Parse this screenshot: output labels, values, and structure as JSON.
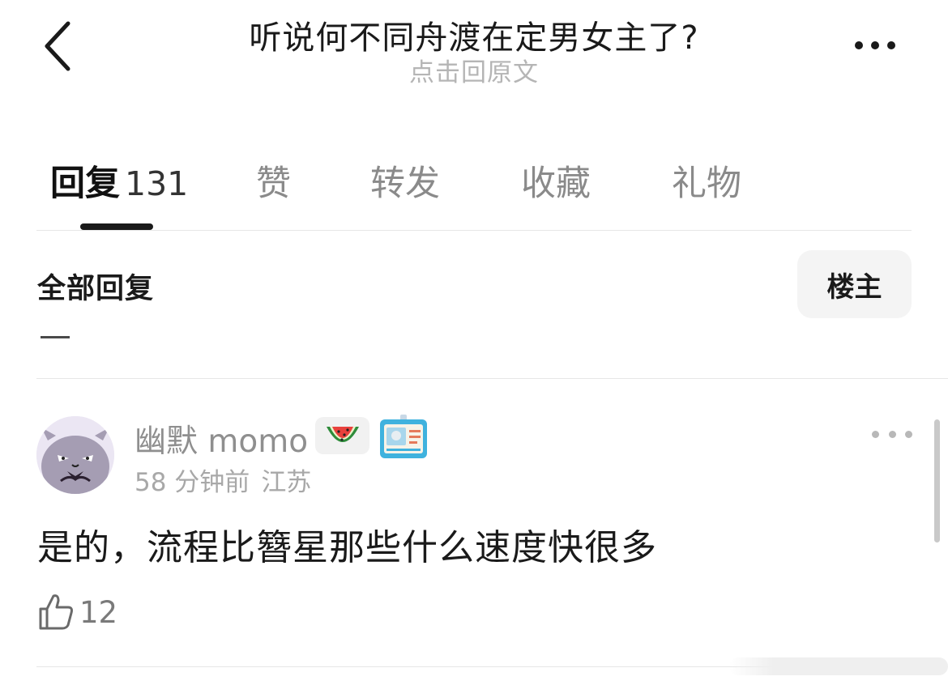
{
  "header": {
    "title": "听说何不同舟渡在定男女主了?",
    "subtitle": "点击回原文",
    "back_icon": "chevron-left-icon",
    "more_icon": "more-horizontal-icon"
  },
  "tabs": [
    {
      "label": "回复",
      "count": "131",
      "active": true
    },
    {
      "label": "赞"
    },
    {
      "label": "转发"
    },
    {
      "label": "收藏"
    },
    {
      "label": "礼物"
    }
  ],
  "section": {
    "title": "全部回复",
    "op_filter_label": "楼主"
  },
  "comment": {
    "avatar_icon": "avatar-cat-icon",
    "username": "幽默 momo",
    "badges": [
      "watermelon-icon",
      "id-card-icon"
    ],
    "time": "58 分钟前",
    "location": "江苏",
    "text": "是的，流程比簪星那些什么速度快很多",
    "like_icon": "thumbs-up-icon",
    "likes": "12"
  },
  "colors": {
    "text_primary": "#1a1a1a",
    "text_secondary": "#8f8f8f",
    "muted": "#b5b5b5",
    "divider": "#e6e6e6",
    "chip_bg": "#f4f4f4"
  }
}
